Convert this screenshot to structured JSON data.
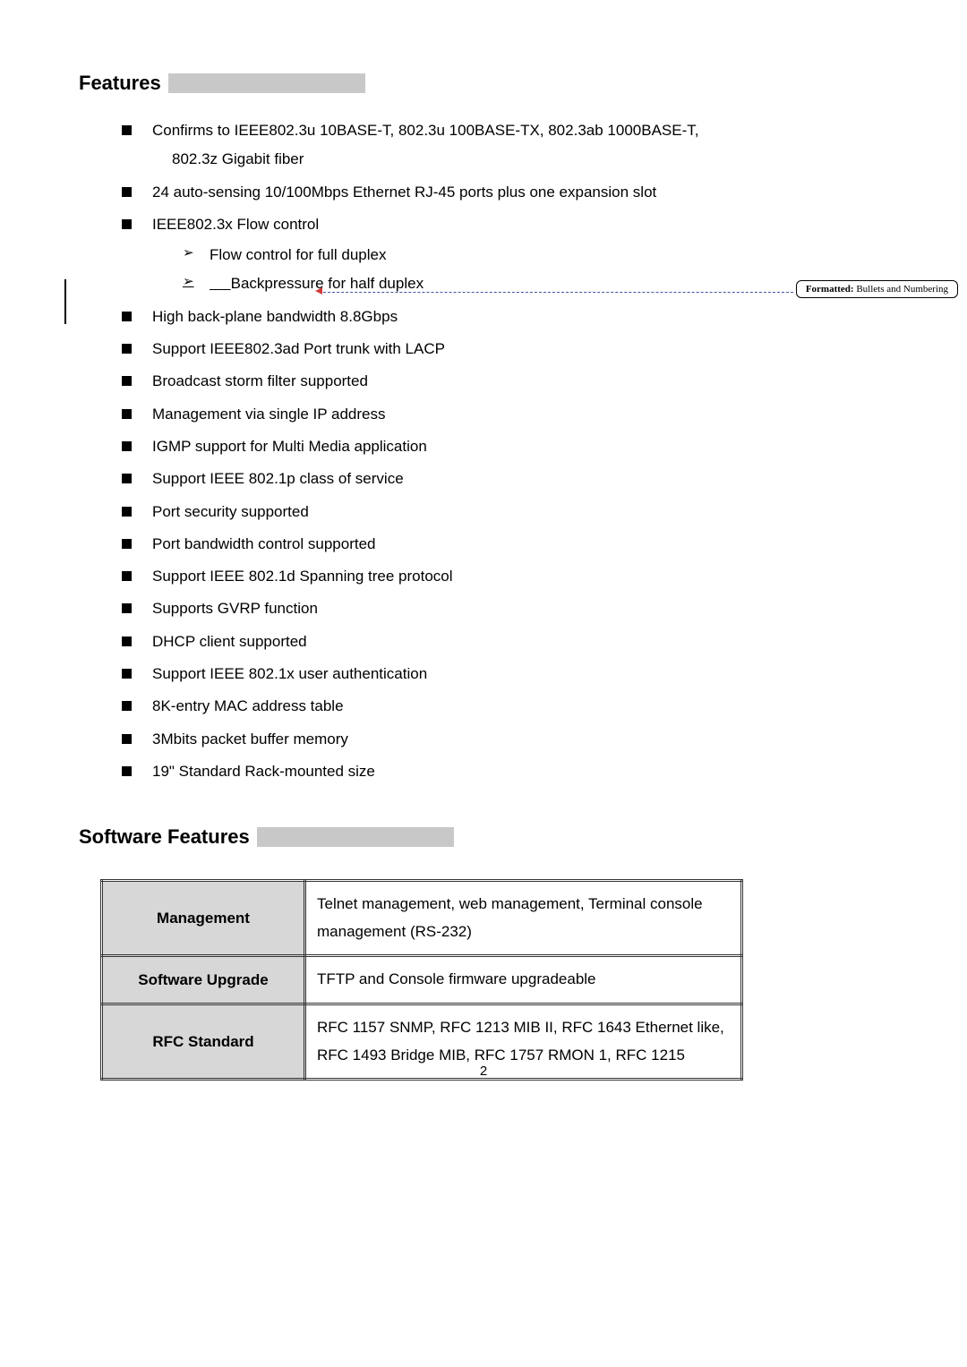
{
  "headings": {
    "features": "Features",
    "software_features": "Software Features"
  },
  "features_list": [
    "Confirms to IEEE802.3u 10BASE-T, 802.3u 100BASE-TX, 802.3ab 1000BASE-T,",
    "24 auto-sensing 10/100Mbps Ethernet RJ-45 ports plus one expansion slot",
    "IEEE802.3x Flow control",
    "High back-plane bandwidth 8.8Gbps",
    "Support IEEE802.3ad Port trunk with LACP",
    "Broadcast storm filter supported",
    "Management via single IP address",
    "IGMP support for Multi Media application",
    "Support IEEE 802.1p class of service",
    "Port security supported",
    "Port bandwidth control supported",
    "Support IEEE 802.1d Spanning tree protocol",
    "Supports GVRP function",
    "DHCP client supported",
    "Support IEEE 802.1x user authentication",
    "8K-entry MAC address table",
    "3Mbits packet buffer memory",
    "19\" Standard Rack-mounted size"
  ],
  "features_sub_line": "802.3z Gigabit fiber",
  "flow_control_sub": [
    "Flow control for full duplex",
    "Backpressure for half duplex"
  ],
  "table": {
    "rows": [
      {
        "header": "Management",
        "value": "Telnet management, web management, Terminal console management (RS-232)"
      },
      {
        "header": "Software Upgrade",
        "value": "TFTP and Console firmware upgradeable"
      },
      {
        "header": "RFC Standard",
        "value": "RFC 1157 SNMP, RFC 1213 MIB II, RFC 1643 Ethernet like, RFC 1493 Bridge MIB, RFC 1757 RMON 1, RFC 1215"
      }
    ]
  },
  "comment": {
    "label": "Formatted:",
    "text": " Bullets and Numbering"
  },
  "page_number": "2"
}
